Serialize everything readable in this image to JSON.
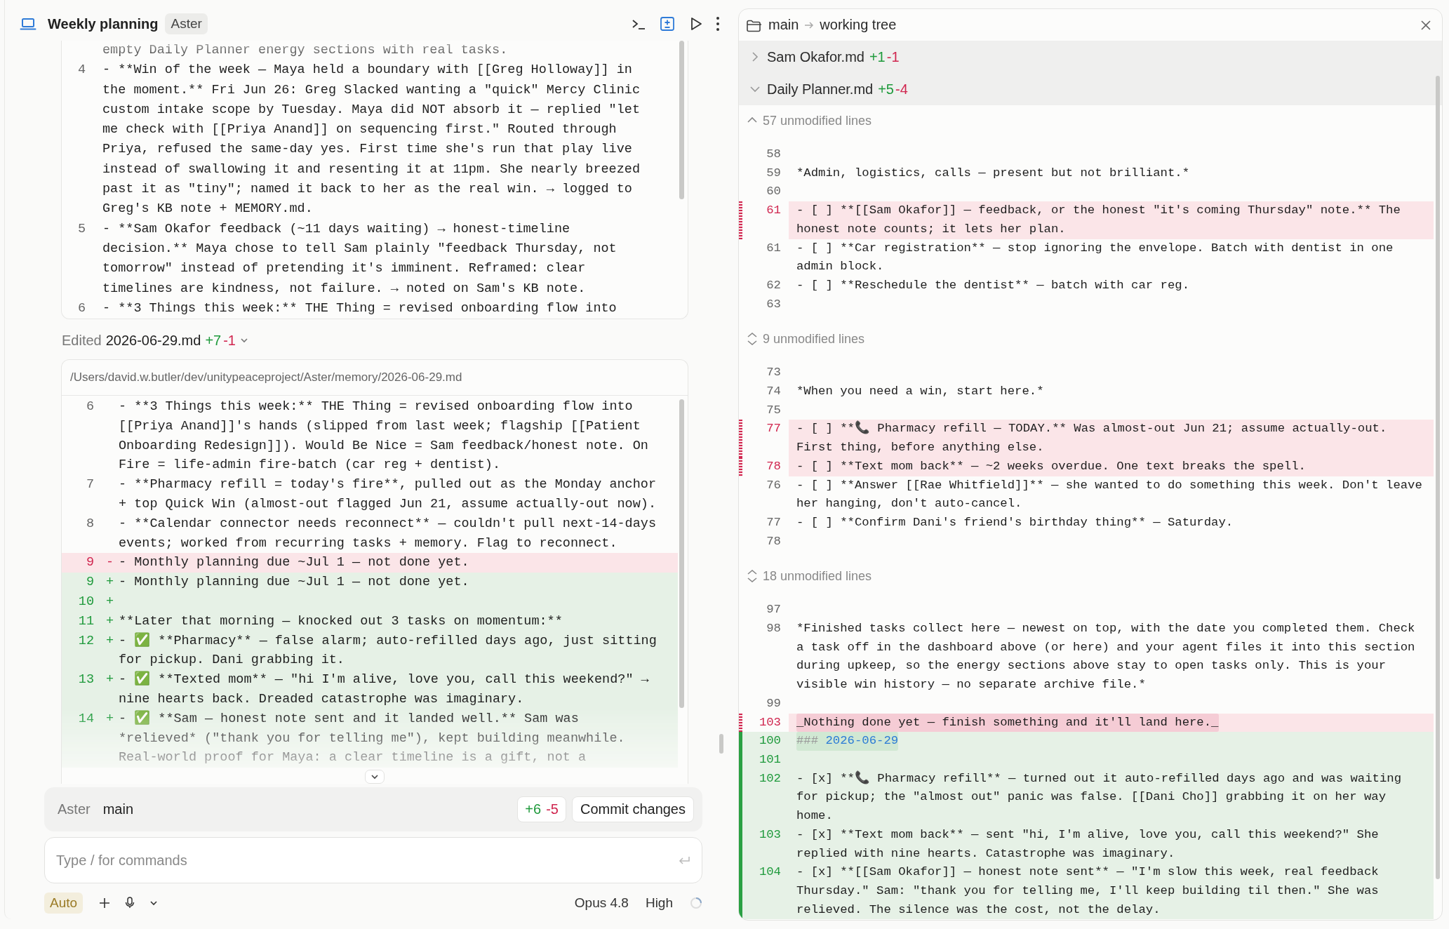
{
  "chat": {
    "title": "Weekly planning",
    "badge": "Aster",
    "previous_diff": {
      "lines": [
        {
          "text": "empty Daily Planner energy sections with real tasks."
        },
        {
          "number": "4",
          "text": "- **Win of the week — Maya held a boundary with [[Greg Holloway]] in the moment.** Fri Jun 26: Greg Slacked wanting a \"quick\" Mercy Clinic custom intake scope by Tuesday. Maya did NOT absorb it — replied \"let me check with [[Priya Anand]] on sequencing first.\" Routed through Priya, refused the same-day yes. First time she's run that play live instead of swallowing it and resenting it at 11pm. She nearly breezed past it as \"tiny\"; named it back to her as the real win. → logged to Greg's KB note + MEMORY.md."
        },
        {
          "number": "5",
          "text": "- **Sam Okafor feedback (~11 days waiting) → honest-timeline decision.** Maya chose to tell Sam plainly \"feedback Thursday, not tomorrow\" instead of pretending it's imminent. Reframed: clear timelines are kindness, not failure. → noted on Sam's KB note."
        },
        {
          "number": "6",
          "text": "- **3 Things this week:** THE Thing = revised onboarding flow into"
        }
      ]
    },
    "edit": {
      "verb": "Edited",
      "file": "2026-06-29.md",
      "added": "+7",
      "removed": "-1"
    },
    "diff": {
      "path": "/Users/david.w.butler/dev/unitypeaceproject/Aster/memory/2026-06-29.md",
      "lines": [
        {
          "number": "6",
          "kind": "context",
          "text": "- **3 Things this week:** THE Thing = revised onboarding flow into [[Priya Anand]]'s hands (slipped from last week; flagship [[Patient Onboarding Redesign]]). Would Be Nice = Sam feedback/honest note. On Fire = life-admin fire-batch (car reg + dentist)."
        },
        {
          "number": "7",
          "kind": "context",
          "text": "- **Pharmacy refill = today's fire**, pulled out as the Monday anchor + top Quick Win (almost-out flagged Jun 21, assume actually-out now)."
        },
        {
          "number": "8",
          "kind": "context",
          "text": "- **Calendar connector needs reconnect** — couldn't pull next-14-days events; worked from recurring tasks + memory. Flag to reconnect."
        },
        {
          "number": "9",
          "kind": "removed",
          "sign": "-",
          "text": "- Monthly planning due ~Jul 1 — not done yet."
        },
        {
          "number": "9",
          "kind": "added",
          "sign": "+",
          "text": "- Monthly planning due ~Jul 1 — not done yet."
        },
        {
          "number": "10",
          "kind": "added",
          "sign": "+"
        },
        {
          "number": "11",
          "kind": "added",
          "sign": "+",
          "text": "**Later that morning — knocked out 3 tasks on momentum:**"
        },
        {
          "number": "12",
          "kind": "added",
          "sign": "+",
          "text": "- ✅ **Pharmacy** — false alarm; auto-refilled days ago, just sitting for pickup. Dani grabbing it."
        },
        {
          "number": "13",
          "kind": "added",
          "sign": "+",
          "text": "- ✅ **Texted mom** — \"hi I'm alive, love you, call this weekend?\" → nine hearts back. Dreaded catastrophe was imaginary."
        },
        {
          "number": "14",
          "kind": "added",
          "sign": "+",
          "text": "- ✅ **Sam — honest note sent and it landed well.** Sam was *relieved* (\"thank you for telling me\"), kept building meanwhile. Real-world proof for Maya: a clear timeline is a gift, not a"
        }
      ]
    },
    "commit_bar": {
      "repo": "Aster",
      "branch": "main",
      "added": "+6",
      "removed": "-5",
      "button": "Commit changes"
    },
    "composer": {
      "placeholder": "Type / for commands"
    },
    "footer": {
      "mode": "Auto",
      "model": "Opus 4.8",
      "effort": "High"
    }
  },
  "diff_panel": {
    "breadcrumb": [
      "main",
      "working tree"
    ],
    "files": [
      {
        "name": "Sam Okafor.md",
        "added": "+1",
        "removed": "-1",
        "expanded": false
      },
      {
        "name": "Daily Planner.md",
        "added": "+5",
        "removed": "-4",
        "expanded": true
      }
    ],
    "rows": [
      {
        "kind": "fold",
        "label": "57 unmodified lines",
        "expanded": true
      },
      {
        "kind": "context",
        "number": "58"
      },
      {
        "kind": "context",
        "number": "59",
        "text": "*Admin, logistics, calls — present but not brilliant.*"
      },
      {
        "kind": "context",
        "number": "60"
      },
      {
        "kind": "removed",
        "number": "61",
        "text": "- [ ] **[[Sam Okafor]] — feedback, or the honest \"it's coming Thursday\" note.** The honest note counts; it lets her plan."
      },
      {
        "kind": "context",
        "number": "61",
        "text": "- [ ] **Car registration** — stop ignoring the envelope. Batch with dentist in one admin block."
      },
      {
        "kind": "context",
        "number": "62",
        "text": "- [ ] **Reschedule the dentist** — batch with car reg."
      },
      {
        "kind": "context",
        "number": "63"
      },
      {
        "kind": "fold",
        "label": "9 unmodified lines",
        "expanded": false
      },
      {
        "kind": "context",
        "number": "73"
      },
      {
        "kind": "context",
        "number": "74",
        "text": "*When you need a win, start here.*"
      },
      {
        "kind": "context",
        "number": "75"
      },
      {
        "kind": "removed",
        "number": "77",
        "text": "- [ ] **📞 Pharmacy refill — TODAY.** Was almost-out Jun 21; assume actually-out. First thing, before anything else."
      },
      {
        "kind": "removed",
        "number": "78",
        "text": "- [ ] **Text mom back** — ~2 weeks overdue. One text breaks the spell."
      },
      {
        "kind": "context",
        "number": "76",
        "text": "- [ ] **Answer [[Rae Whitfield]]** — she wanted to do something this week. Don't leave her hanging, don't auto-cancel."
      },
      {
        "kind": "context",
        "number": "77",
        "text": "- [ ] **Confirm Dani's friend's birthday thing** — Saturday."
      },
      {
        "kind": "context",
        "number": "78"
      },
      {
        "kind": "fold",
        "label": "18 unmodified lines",
        "expanded": false
      },
      {
        "kind": "context",
        "number": "97"
      },
      {
        "kind": "context",
        "number": "98",
        "text": "*Finished tasks collect here — newest on top, with the date you completed them. Check a task off in the dashboard above (or here) and your agent files it into this section during upkeep, so the energy sections above stay to open tasks only. This is your visible win history — no separate archive file.*"
      },
      {
        "kind": "context",
        "number": "99"
      },
      {
        "kind": "removed",
        "number": "103",
        "highlight": true,
        "text": "_Nothing done yet — finish something and it'll land here._"
      },
      {
        "kind": "added",
        "number": "100",
        "highlight": true,
        "marker": "###",
        "text": "2026-06-29"
      },
      {
        "kind": "added",
        "number": "101"
      },
      {
        "kind": "added",
        "number": "102",
        "text": "- [x] **📞 Pharmacy refill** — turned out it auto-refilled days ago and was waiting for pickup; the \"almost out\" panic was false. [[Dani Cho]] grabbing it on her way home."
      },
      {
        "kind": "added",
        "number": "103",
        "text": "- [x] **Text mom back** — sent \"hi, I'm alive, love you, call this weekend?\" She replied with nine hearts. Catastrophe was imaginary."
      },
      {
        "kind": "added",
        "number": "104",
        "text": "- [x] **[[Sam Okafor]] — honest note sent** — \"I'm slow this week, real feedback Thursday.\" Sam: \"thank you for telling me, I'll keep building til then.\" She was relieved. The silence was the cost, not the delay."
      }
    ]
  }
}
